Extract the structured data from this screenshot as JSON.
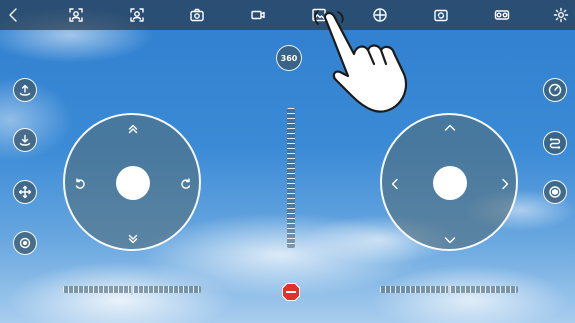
{
  "app": {
    "camera_badge_label": "360"
  },
  "toolbar": {
    "items": [
      {
        "name": "back",
        "icon": "chevron-left-icon"
      },
      {
        "name": "gesture-photo",
        "icon": "face-frame-icon"
      },
      {
        "name": "gesture-video",
        "icon": "face-frame-icon"
      },
      {
        "name": "photo",
        "icon": "camera-icon"
      },
      {
        "name": "video",
        "icon": "video-camera-icon"
      },
      {
        "name": "gallery",
        "icon": "image-icon"
      },
      {
        "name": "headless-mode",
        "icon": "crosshair-icon"
      },
      {
        "name": "switch-camera",
        "icon": "rotate-camera-icon"
      },
      {
        "name": "vr-mode",
        "icon": "vr-glasses-icon"
      },
      {
        "name": "settings",
        "icon": "gear-icon"
      }
    ]
  },
  "left_controls": [
    {
      "name": "takeoff",
      "icon": "takeoff-icon"
    },
    {
      "name": "land",
      "icon": "land-icon"
    },
    {
      "name": "move",
      "icon": "move-arrows-icon"
    },
    {
      "name": "calibrate",
      "icon": "target-icon"
    }
  ],
  "right_controls": [
    {
      "name": "speed",
      "icon": "speedometer-icon"
    },
    {
      "name": "route",
      "icon": "route-icon"
    },
    {
      "name": "gravity",
      "icon": "gravity-sensor-icon"
    }
  ],
  "colors": {
    "toolbar_bg": "#3c5a6e",
    "control_bg": "#50707d",
    "stop_red": "#e2302b",
    "sky": "#3a8ad6"
  }
}
